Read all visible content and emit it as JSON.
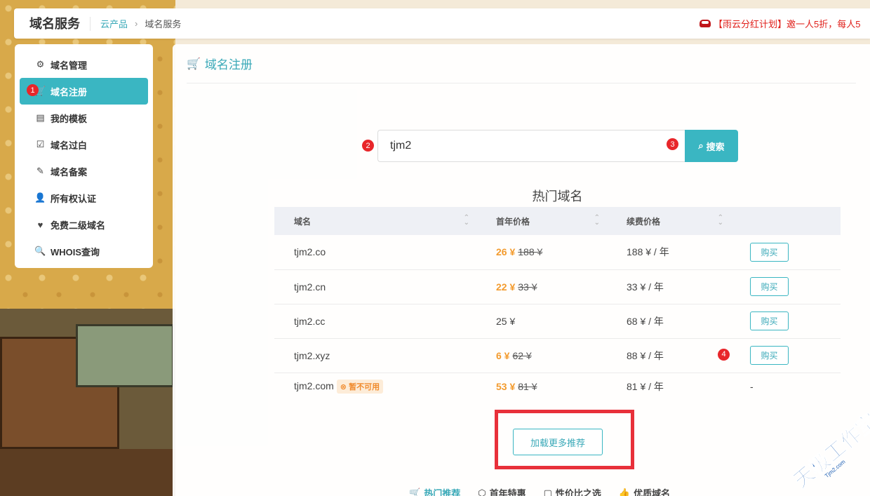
{
  "topbar": {
    "title": "域名服务",
    "breadcrumb": {
      "link": "云产品",
      "separator": "›",
      "current": "域名服务"
    },
    "notice": "【雨云分红计划】邀一人5折，每人5"
  },
  "sidebar": {
    "items": [
      {
        "label": "域名管理",
        "icon": "gears-icon"
      },
      {
        "label": "域名注册",
        "icon": "cart-icon",
        "active": true,
        "badge": "1"
      },
      {
        "label": "我的模板",
        "icon": "id-card-icon"
      },
      {
        "label": "域名过白",
        "icon": "inbox-check-icon"
      },
      {
        "label": "域名备案",
        "icon": "file-signature-icon"
      },
      {
        "label": "所有权认证",
        "icon": "user-check-icon"
      },
      {
        "label": "免费二级域名",
        "icon": "heart-icon"
      },
      {
        "label": "WHOIS查询",
        "icon": "search-icon"
      }
    ]
  },
  "main": {
    "header_title": "域名注册",
    "search": {
      "value": "tjm2",
      "button_label": "搜索",
      "badge_input": "2",
      "badge_button": "3"
    },
    "hot_title": "热门域名",
    "table": {
      "columns": [
        "域名",
        "首年价格",
        "续费价格",
        ""
      ],
      "rows": [
        {
          "domain": "tjm2.co",
          "price_now": "26 ¥",
          "price_old": "188 ¥",
          "renew": "188 ¥ / 年",
          "action": "购买"
        },
        {
          "domain": "tjm2.cn",
          "price_now": "22 ¥",
          "price_old": "33 ¥",
          "renew": "33 ¥ / 年",
          "action": "购买"
        },
        {
          "domain": "tjm2.cc",
          "price_plain": "25 ¥",
          "renew": "68 ¥ / 年",
          "action": "购买"
        },
        {
          "domain": "tjm2.xyz",
          "price_now": "6 ¥",
          "price_old": "62 ¥",
          "renew": "88 ¥ / 年",
          "action": "购买",
          "badge": "4"
        },
        {
          "domain": "tjm2.com",
          "tag": "暂不可用",
          "price_now": "53 ¥",
          "price_old": "81 ¥",
          "renew": "81 ¥ / 年",
          "action": "-"
        }
      ]
    },
    "load_more": "加载更多推荐",
    "bottom_tabs": [
      {
        "label": "热门推荐",
        "icon": "cart-icon",
        "active": true
      },
      {
        "label": "首年特惠",
        "icon": "tag-icon"
      },
      {
        "label": "性价比之选",
        "icon": "box-icon"
      },
      {
        "label": "优质域名",
        "icon": "thumbs-up-icon"
      }
    ]
  },
  "watermark": {
    "text": "天极工作室",
    "sub": "Tjm2.com"
  },
  "colors": {
    "accent": "#3ab6c2",
    "price": "#f39b2e",
    "badge": "#e8262a",
    "highlight_box": "#e8303a"
  }
}
